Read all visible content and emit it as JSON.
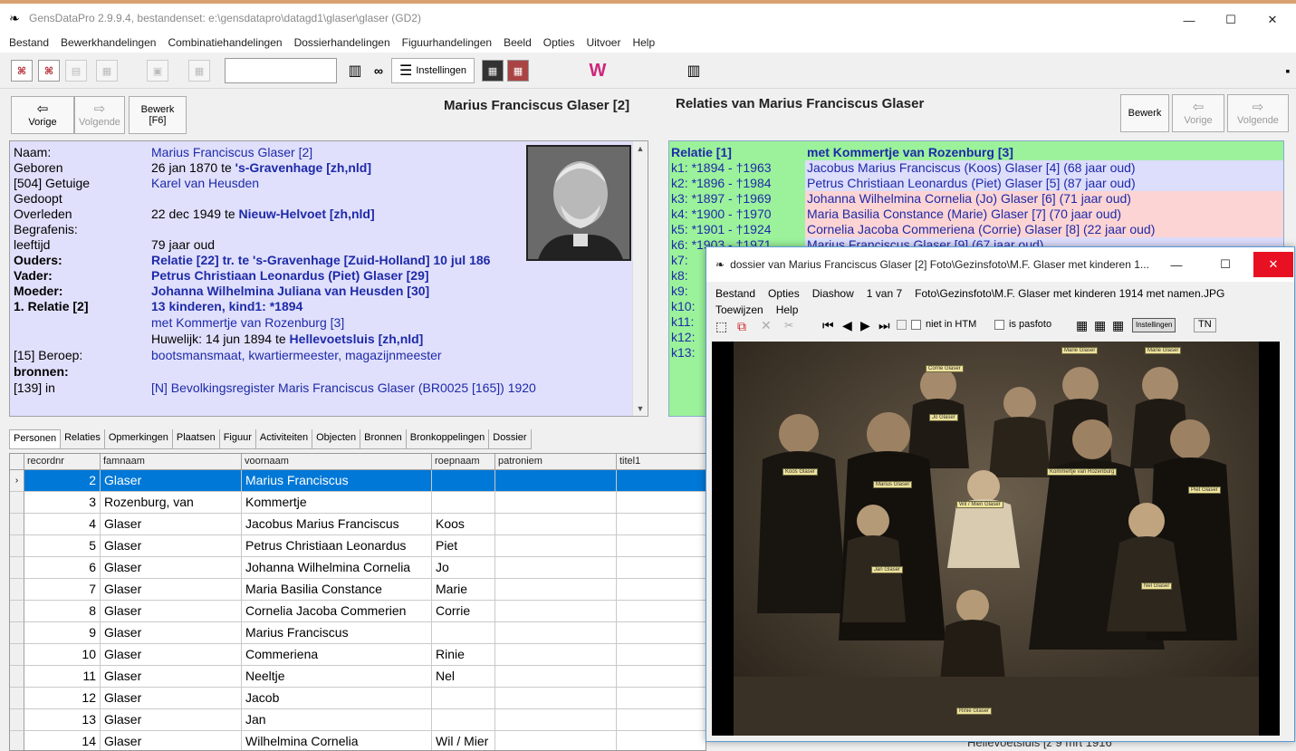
{
  "window": {
    "title": "GensDataPro 2.9.9.4, bestandenset: e:\\gensdatapro\\datagd1\\glaser\\glaser (GD2)",
    "min": "—",
    "max": "☐",
    "close": "✕"
  },
  "menubar": [
    "Bestand",
    "Bewerkhandelingen",
    "Combinatiehandelingen",
    "Dossierhandelingen",
    "Figuurhandelingen",
    "Beeld",
    "Opties",
    "Uitvoer",
    "Help"
  ],
  "toolbar": {
    "instellingen": "Instellingen",
    "search_value": ""
  },
  "left": {
    "prev_label": "Vorige",
    "next_label": "Volgende",
    "edit_label": "Bewerk",
    "edit_key": "[F6]",
    "person_title": "Marius Franciscus Glaser [2]",
    "details": [
      {
        "label": "Naam:",
        "value": "Marius Franciscus Glaser [2]",
        "label_style": "plain",
        "value_style": "blue"
      },
      {
        "label": "Geboren",
        "value_prefix": "26 jan 1870 te ",
        "value_bold": "'s-Gravenhage [zh,nld]",
        "label_style": "plain"
      },
      {
        "label": "[504] Getuige",
        "value": "Karel van Heusden",
        "label_style": "blue",
        "value_style": "blue"
      },
      {
        "label": "Gedoopt",
        "value": "",
        "label_style": "plain"
      },
      {
        "label": "Overleden",
        "value_prefix": "22 dec 1949 te ",
        "value_bold": "Nieuw-Helvoet [zh,nld]",
        "label_style": "plain"
      },
      {
        "label": "Begrafenis:",
        "value": "",
        "label_style": "plain"
      },
      {
        "label": "leeftijd",
        "value": "79 jaar oud",
        "label_style": "plain",
        "value_style": "plain"
      },
      {
        "label": "Ouders:",
        "value": "Relatie [22] tr. te 's-Gravenhage [Zuid-Holland] 10 jul 186",
        "label_style": "bluebold",
        "value_style": "bluebold"
      },
      {
        "label": "Vader:",
        "value": "Petrus Christiaan Leonardus (Piet) Glaser [29]",
        "label_style": "bluebold",
        "value_style": "bluebold"
      },
      {
        "label": "Moeder:",
        "value": "Johanna Wilhelmina Juliana van Heusden [30]",
        "label_style": "bluebold",
        "value_style": "bluebold"
      },
      {
        "label": "1. Relatie [2]",
        "value": "13 kinderen, kind1: *1894",
        "label_style": "bluebold",
        "value_style": "bluebold"
      },
      {
        "label": "",
        "value": "met Kommertje van Rozenburg [3]",
        "label_style": "plain",
        "value_style": "blue"
      },
      {
        "label": "",
        "value_prefix": "Huwelijk: 14 jun 1894 te ",
        "value_bold": "Hellevoetsluis [zh,nld]",
        "label_style": "plain"
      },
      {
        "label": "[15] Beroep:",
        "value": "bootsmansmaat, kwartiermeester, magazijnmeester",
        "label_style": "blue",
        "value_style": "blue"
      },
      {
        "label": "bronnen:",
        "value": "",
        "label_style": "bold"
      },
      {
        "label": "[139] in",
        "value": "[N] Bevolkingsregister Maris Franciscus Glaser (BR0025 [165]) 1920",
        "label_style": "blue",
        "value_style": "blue"
      }
    ]
  },
  "right": {
    "title": "Relaties van Marius Franciscus Glaser",
    "edit_label": "Bewerk",
    "prev_label": "Vorige",
    "next_label": "Volgende",
    "header": {
      "k": "Relatie [1]",
      "n": "met Kommertje van Rozenburg [3]"
    },
    "children": [
      {
        "k": "k1: *1894 - †1963",
        "n": "Jacobus Marius Franciscus (Koos) Glaser [4] (68 jaar oud)",
        "bg": "#ddddfc"
      },
      {
        "k": "k2: *1896 - †1984",
        "n": "Petrus Christiaan Leonardus (Piet) Glaser [5] (87 jaar oud)",
        "bg": "#ddddfc"
      },
      {
        "k": "k3: *1897 - †1969",
        "n": "Johanna Wilhelmina Cornelia (Jo) Glaser [6] (71 jaar oud)",
        "bg": "#fcd4d4"
      },
      {
        "k": "k4: *1900 - †1970",
        "n": "Maria Basilia Constance (Marie) Glaser [7] (70 jaar oud)",
        "bg": "#fcd4d4"
      },
      {
        "k": "k5: *1901 - †1924",
        "n": "Cornelia Jacoba Commeriena (Corrie) Glaser [8] (22 jaar oud)",
        "bg": "#fcd4d4"
      },
      {
        "k": "k6: *1903 - †1971",
        "n": "Marius Franciscus Glaser [9] (67 jaar oud)",
        "bg": "#ddddfc"
      },
      {
        "k": "k7:",
        "n": "",
        "bg": ""
      },
      {
        "k": "k8:",
        "n": "",
        "bg": ""
      },
      {
        "k": "k9:",
        "n": "",
        "bg": ""
      },
      {
        "k": "k10:",
        "n": "",
        "bg": ""
      },
      {
        "k": "k11:",
        "n": "",
        "bg": ""
      },
      {
        "k": "k12:",
        "n": "",
        "bg": ""
      },
      {
        "k": "k13:",
        "n": "",
        "bg": ""
      }
    ]
  },
  "tabs": [
    "Personen",
    "Relaties",
    "Opmerkingen",
    "Plaatsen",
    "Figuur",
    "Activiteiten",
    "Objecten",
    "Bronnen",
    "Bronkoppelingen",
    "Dossier"
  ],
  "grid": {
    "columns": [
      "recordnr",
      "famnaam",
      "voornaam",
      "roepnaam",
      "patroniem",
      "titel1"
    ],
    "rows": [
      [
        "2",
        "Glaser",
        "Marius Franciscus",
        "",
        "",
        ""
      ],
      [
        "3",
        "Rozenburg, van",
        "Kommertje",
        "",
        "",
        ""
      ],
      [
        "4",
        "Glaser",
        "Jacobus Marius Franciscus",
        "Koos",
        "",
        ""
      ],
      [
        "5",
        "Glaser",
        "Petrus Christiaan Leonardus",
        "Piet",
        "",
        ""
      ],
      [
        "6",
        "Glaser",
        "Johanna Wilhelmina Cornelia",
        "Jo",
        "",
        ""
      ],
      [
        "7",
        "Glaser",
        "Maria Basilia Constance",
        "Marie",
        "",
        ""
      ],
      [
        "8",
        "Glaser",
        "Cornelia Jacoba Commerien",
        "Corrie",
        "",
        ""
      ],
      [
        "9",
        "Glaser",
        "Marius Franciscus",
        "",
        "",
        ""
      ],
      [
        "10",
        "Glaser",
        "Commeriena",
        "Rinie",
        "",
        ""
      ],
      [
        "11",
        "Glaser",
        "Neeltje",
        "Nel",
        "",
        ""
      ],
      [
        "12",
        "Glaser",
        "Jacob",
        "",
        "",
        ""
      ],
      [
        "13",
        "Glaser",
        "Jan",
        "",
        "",
        ""
      ],
      [
        "14",
        "Glaser",
        "Wilhelmina Cornelia",
        "Wil / Mier",
        "",
        ""
      ]
    ]
  },
  "dossier": {
    "title": "dossier van Marius Franciscus Glaser [2] Foto\\Gezinsfoto\\M.F. Glaser met kinderen 1...",
    "menu": [
      "Bestand",
      "Opties",
      "Diashow",
      "1 van 7",
      "Foto\\Gezinsfoto\\M.F. Glaser met kinderen 1914 met namen.JPG"
    ],
    "menu2": [
      "Toewijzen",
      "Help"
    ],
    "niet_in_htm": "niet in HTM",
    "is_pasfoto": "is pasfoto",
    "instellingen": "Instellingen",
    "tn": "TN",
    "tags": [
      "Marie Glaser",
      "Marie Glaser",
      "Corrie Glaser",
      "Jo Glaser",
      "Koos Glaser",
      "Marius Glaser",
      "Kommertje van Rozenburg",
      "Piet Glaser",
      "Wil / Mien Glaser",
      "Jan Glaser",
      "Nel Glaser",
      "Rinie Glaser"
    ]
  },
  "bg_tail": "Hellevoetsluis [z   9 mrt 1916"
}
